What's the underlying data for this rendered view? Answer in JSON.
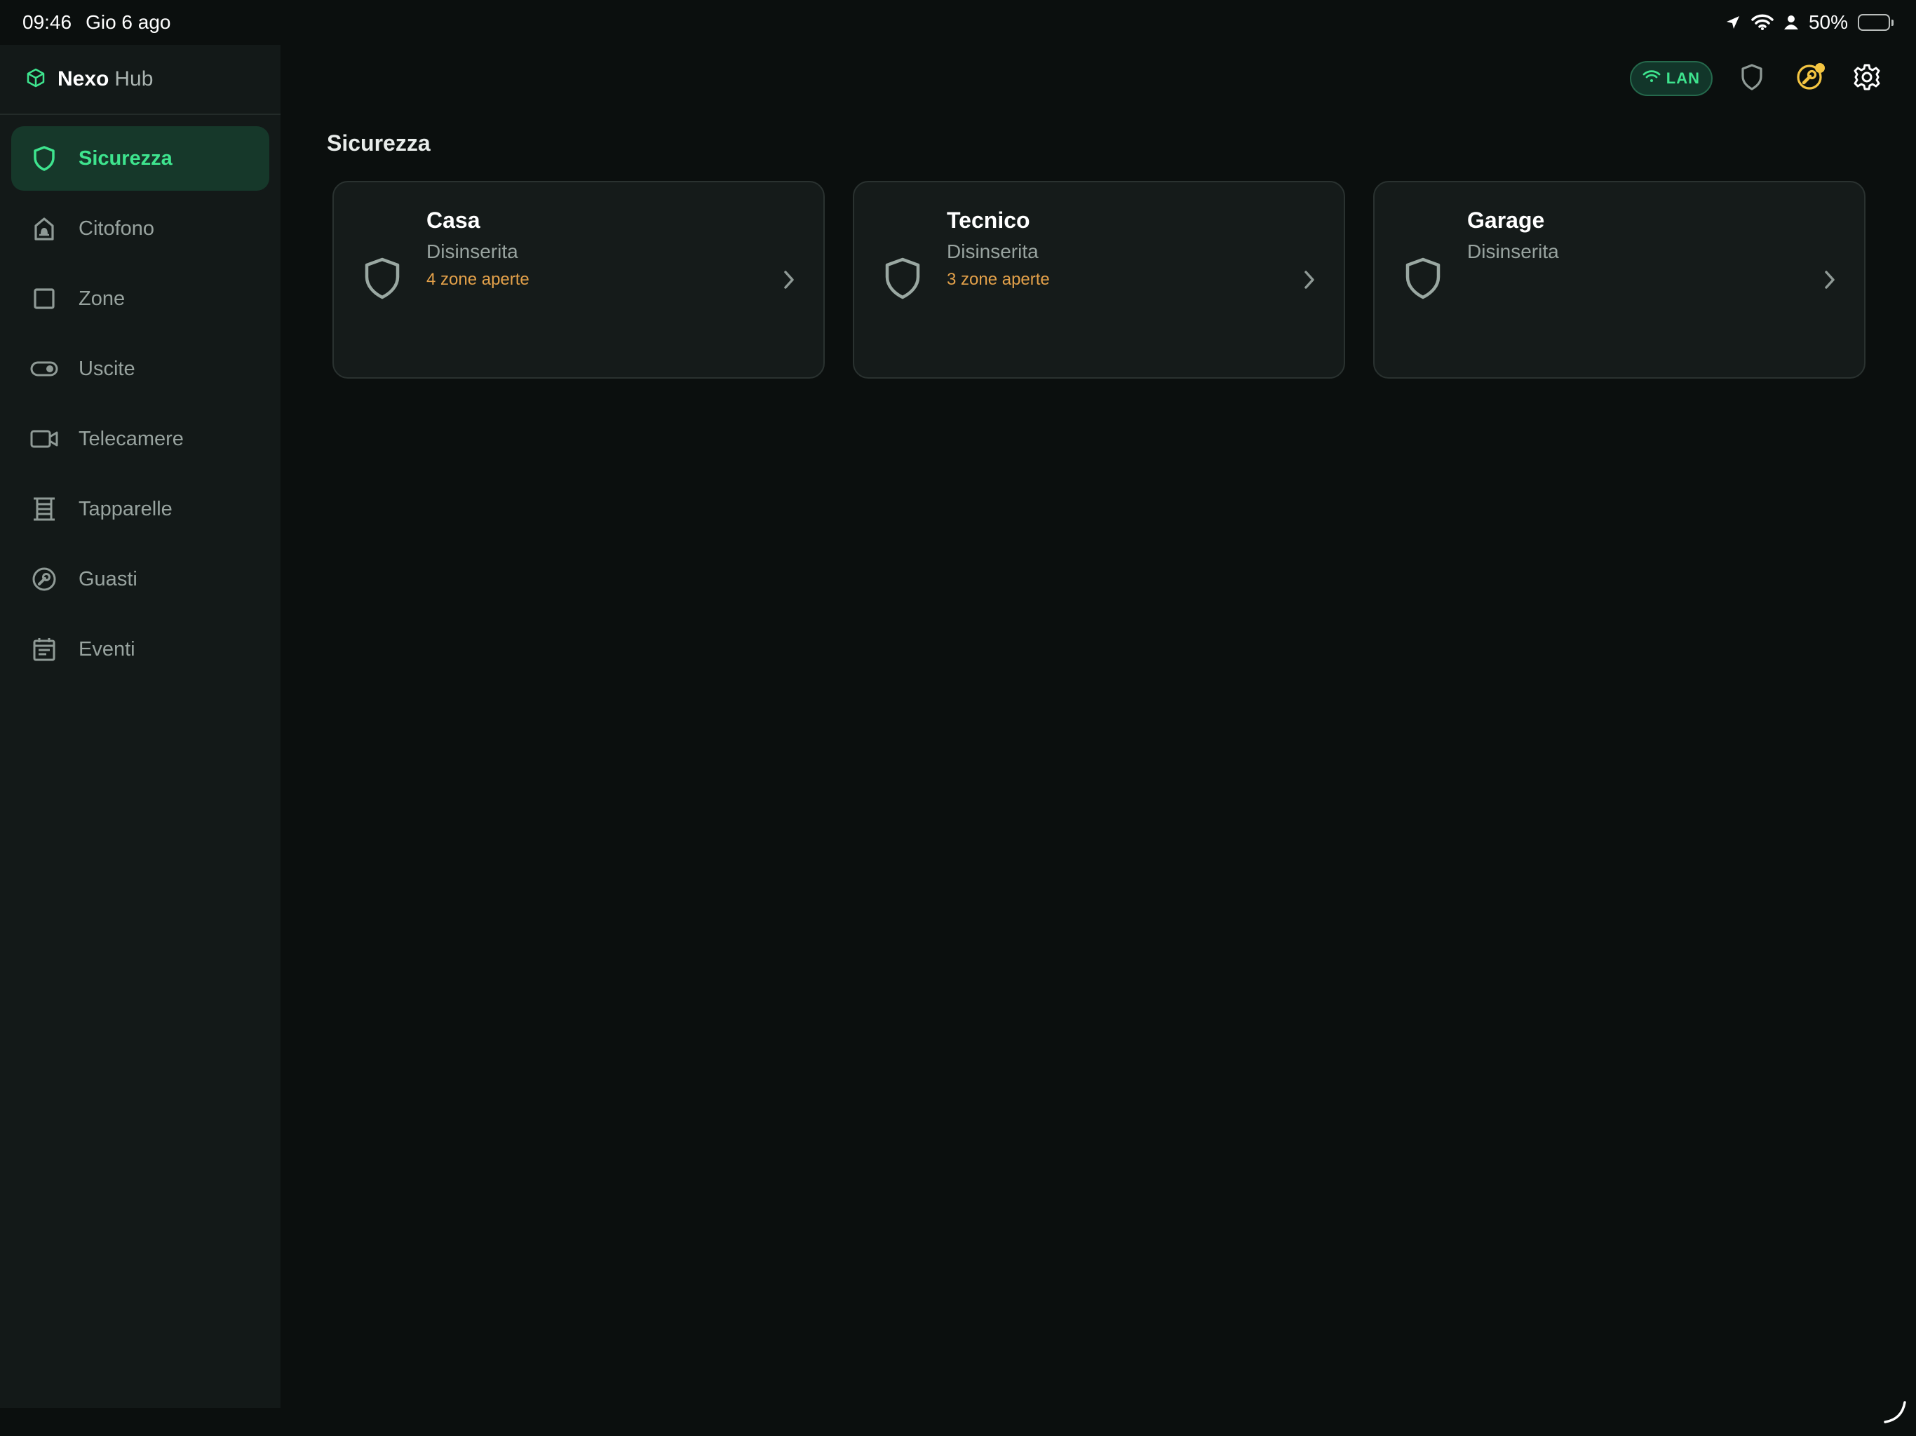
{
  "status_bar": {
    "time": "09:46",
    "date": "Gio 6 ago",
    "battery_percent": "50%",
    "battery_level": 0.5
  },
  "sidebar": {
    "brand_name": "Nexo",
    "brand_sub": "Hub",
    "items": [
      {
        "label": "Sicurezza",
        "icon": "shield-icon",
        "active": true
      },
      {
        "label": "Citofono",
        "icon": "intercom-icon",
        "active": false
      },
      {
        "label": "Zone",
        "icon": "square-icon",
        "active": false
      },
      {
        "label": "Uscite",
        "icon": "toggle-icon",
        "active": false
      },
      {
        "label": "Telecamere",
        "icon": "camera-icon",
        "active": false
      },
      {
        "label": "Tapparelle",
        "icon": "shutter-icon",
        "active": false
      },
      {
        "label": "Guasti",
        "icon": "wrench-icon",
        "active": false
      },
      {
        "label": "Eventi",
        "icon": "calendar-icon",
        "active": false
      }
    ]
  },
  "header": {
    "connection_label": "LAN"
  },
  "main": {
    "title": "Sicurezza",
    "areas": [
      {
        "name": "Casa",
        "status": "Disinserita",
        "warning": "4 zone aperte"
      },
      {
        "name": "Tecnico",
        "status": "Disinserita",
        "warning": "3 zone aperte"
      },
      {
        "name": "Garage",
        "status": "Disinserita",
        "warning": ""
      }
    ]
  },
  "colors": {
    "background": "#0b0f0e",
    "sidebar": "#131918",
    "accent": "#3ee48e",
    "warning": "#e3a14a",
    "notification": "#f4c542"
  }
}
